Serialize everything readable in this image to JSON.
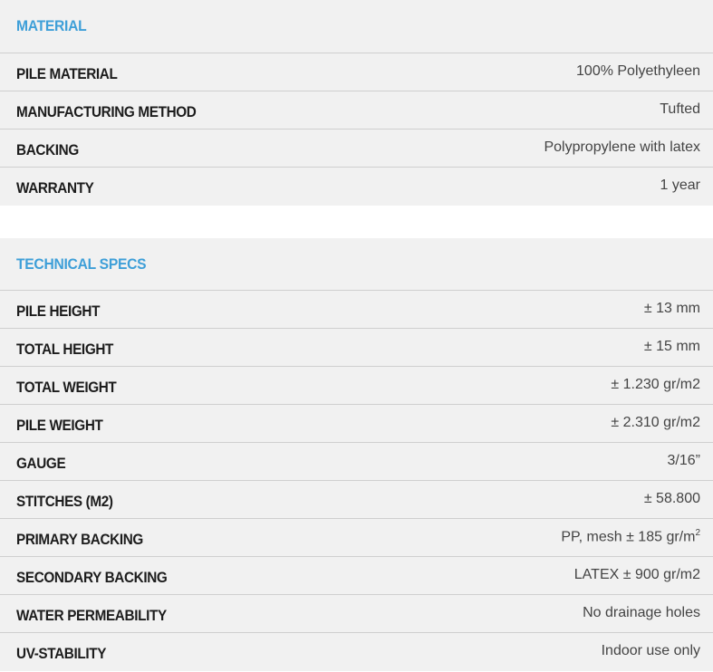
{
  "material": {
    "title": "MATERIAL",
    "rows": [
      {
        "label": "PILE MATERIAL",
        "value": "100% Polyethyleen"
      },
      {
        "label": "MANUFACTURING METHOD",
        "value": "Tufted"
      },
      {
        "label": "BACKING",
        "value": "Polypropylene with latex"
      },
      {
        "label": "WARRANTY",
        "value": "1 year"
      }
    ]
  },
  "technical": {
    "title": "TECHNICAL SPECS",
    "rows": [
      {
        "label": "PILE HEIGHT",
        "value": "± 13 mm"
      },
      {
        "label": "TOTAL HEIGHT",
        "value": "± 15 mm"
      },
      {
        "label": "TOTAL WEIGHT",
        "value": "± 1.230 gr/m2"
      },
      {
        "label": "PILE WEIGHT",
        "value": "± 2.310 gr/m2"
      },
      {
        "label": "GAUGE",
        "value": "3/16”"
      },
      {
        "label": "STITCHES (M2)",
        "value": "± 58.800"
      },
      {
        "label": "PRIMARY BACKING",
        "value": "PP, mesh ± 185 gr/m",
        "value_sup": "2"
      },
      {
        "label": "SECONDARY BACKING",
        "value": "LATEX ± 900 gr/m2"
      },
      {
        "label": "WATER PERMEABILITY",
        "value": "No drainage holes"
      },
      {
        "label": "UV-STABILITY",
        "value": "Indoor use only"
      }
    ]
  },
  "colors": {
    "accent": "#3e9fd8",
    "row_background": "#f1f1f1",
    "divider": "#cfcfcf",
    "label_text": "#1c1c1c",
    "value_text": "#444444"
  }
}
